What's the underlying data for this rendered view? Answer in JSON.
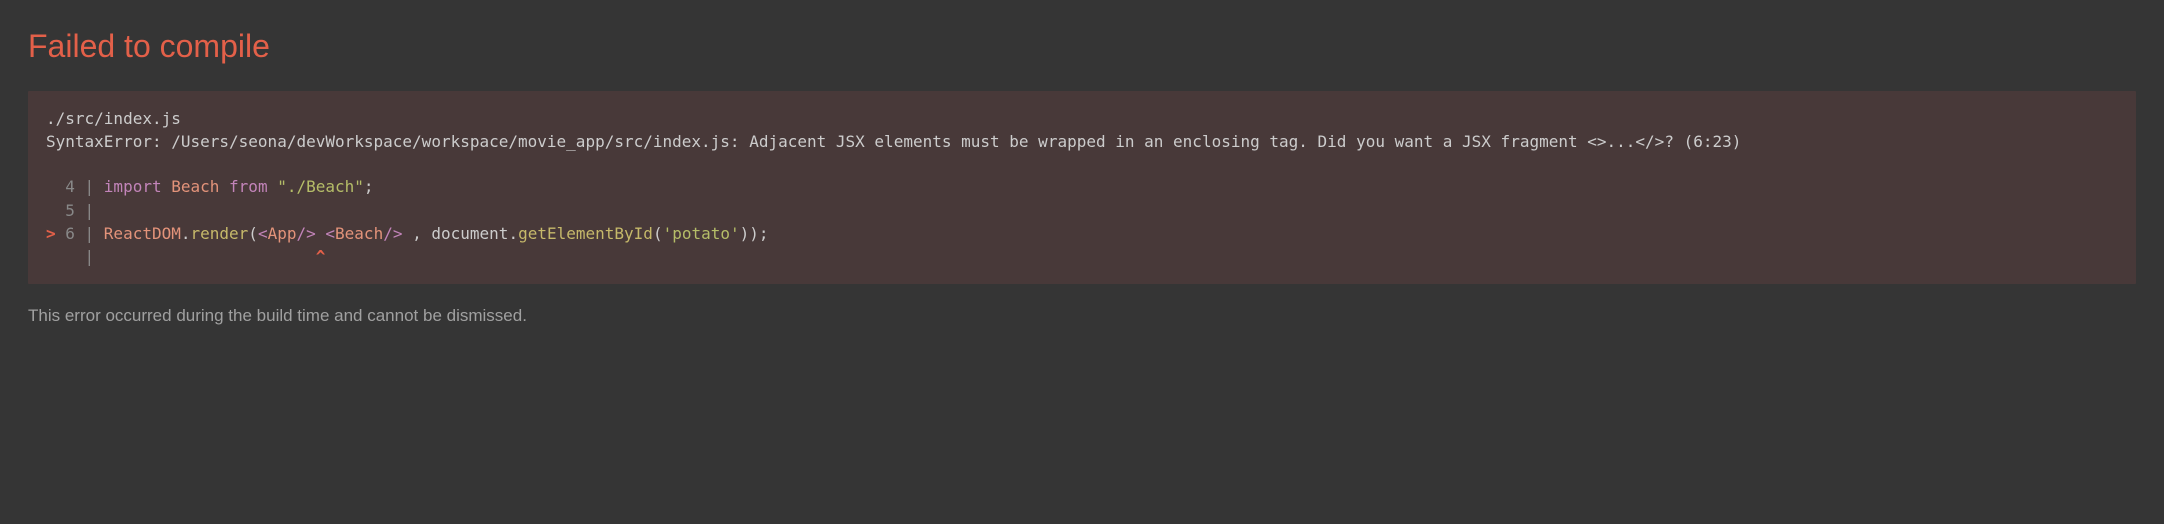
{
  "header": {
    "title": "Failed to compile"
  },
  "error": {
    "file": "./src/index.js",
    "message": "SyntaxError: /Users/seona/devWorkspace/workspace/movie_app/src/index.js: Adjacent JSX elements must be wrapped in an enclosing tag. Did you want a JSX fragment <>...</>? (6:23)"
  },
  "code": {
    "lines": [
      {
        "gutter": "  4 | ",
        "tokens": [
          {
            "t": "import ",
            "c": "kw"
          },
          {
            "t": "Beach",
            "c": "cls"
          },
          {
            "t": " from ",
            "c": "kw"
          },
          {
            "t": "\"./Beach\"",
            "c": "str"
          },
          {
            "t": ";",
            "c": "plain"
          }
        ]
      },
      {
        "gutter": "  5 | ",
        "tokens": []
      },
      {
        "marker": "> ",
        "gutter": "6 | ",
        "tokens": [
          {
            "t": "ReactDOM",
            "c": "cls"
          },
          {
            "t": ".",
            "c": "plain"
          },
          {
            "t": "render",
            "c": "fn"
          },
          {
            "t": "(",
            "c": "plain"
          },
          {
            "t": "<",
            "c": "jsx"
          },
          {
            "t": "App",
            "c": "jsx-name"
          },
          {
            "t": "/>",
            "c": "jsx"
          },
          {
            "t": " ",
            "c": "plain"
          },
          {
            "t": "<",
            "c": "jsx"
          },
          {
            "t": "Beach",
            "c": "jsx-name"
          },
          {
            "t": "/>",
            "c": "jsx"
          },
          {
            "t": " , ",
            "c": "plain"
          },
          {
            "t": "document",
            "c": "plain"
          },
          {
            "t": ".",
            "c": "plain"
          },
          {
            "t": "getElementById",
            "c": "fn"
          },
          {
            "t": "(",
            "c": "plain"
          },
          {
            "t": "'potato'",
            "c": "str"
          },
          {
            "t": "));",
            "c": "plain"
          }
        ]
      },
      {
        "gutter": "    | ",
        "tokens": [
          {
            "t": "                      ",
            "c": "plain"
          },
          {
            "t": "^",
            "c": "caret"
          }
        ]
      }
    ]
  },
  "footer": {
    "note": "This error occurred during the build time and cannot be dismissed."
  }
}
